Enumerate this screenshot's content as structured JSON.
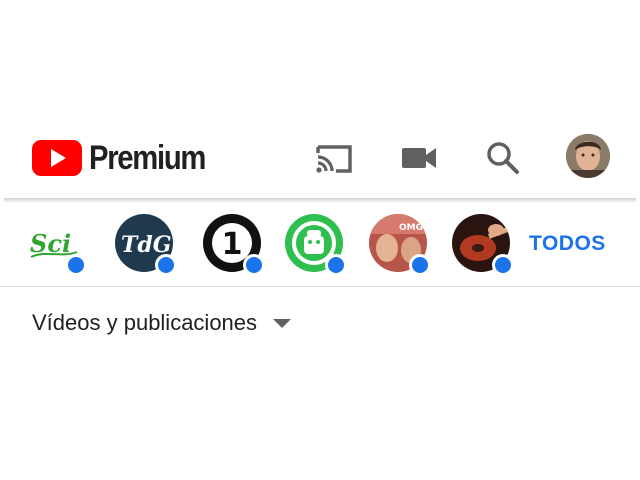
{
  "app": {
    "brand_text": "Premium"
  },
  "header": {
    "icons": [
      "cast-icon",
      "camera-icon",
      "search-icon"
    ],
    "avatar": "user-avatar"
  },
  "subscriptions": {
    "channels": [
      {
        "name": "channel-sci",
        "logo_text": "Sci",
        "new_content": true
      },
      {
        "name": "channel-tdg",
        "logo_text": "TdG",
        "new_content": true
      },
      {
        "name": "channel-1",
        "logo_text": "1",
        "new_content": true
      },
      {
        "name": "channel-android",
        "logo_text": "",
        "new_content": true
      },
      {
        "name": "channel-omg",
        "logo_text": "OMG!",
        "new_content": true
      },
      {
        "name": "channel-guitar",
        "logo_text": "",
        "new_content": true
      }
    ],
    "all_label": "TODOS"
  },
  "filter": {
    "label": "Vídeos y publicaciones"
  },
  "colors": {
    "brand_red": "#ff0000",
    "accent_blue": "#1a73e8",
    "text": "#212121",
    "icon_gray": "#606060"
  }
}
